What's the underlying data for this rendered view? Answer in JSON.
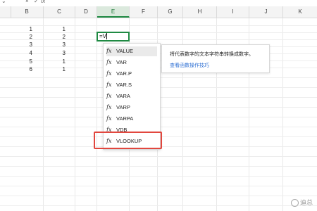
{
  "toolbar": {
    "controls": [
      "⌄",
      "×",
      "✓",
      "fx"
    ]
  },
  "columns": [
    "B",
    "C",
    "D",
    "E",
    "F",
    "G",
    "H",
    "I",
    "J",
    "K"
  ],
  "active_column": "E",
  "cells": {
    "B": [
      "1",
      "2",
      "3",
      "4",
      "5",
      "6"
    ],
    "C": [
      "1",
      "2",
      "3",
      "3",
      "1",
      "1"
    ]
  },
  "active_cell": {
    "content": "=V"
  },
  "autocomplete": {
    "icon": "fx-icon",
    "items": [
      "VALUE",
      "VAR",
      "VAR.P",
      "VAR.S",
      "VARA",
      "VARP",
      "VARPA",
      "VDB",
      "VLOOKUP"
    ],
    "selected_index": 0,
    "highlighted_index": 8
  },
  "tooltip": {
    "description": "将代表数字的文本字符串转换成数字。",
    "link": "查看函数操作技巧"
  },
  "colors": {
    "accent": "#1f8a43",
    "highlight": "#e2473e",
    "link": "#2d6fd3"
  },
  "watermark": {
    "text": "迪总"
  }
}
